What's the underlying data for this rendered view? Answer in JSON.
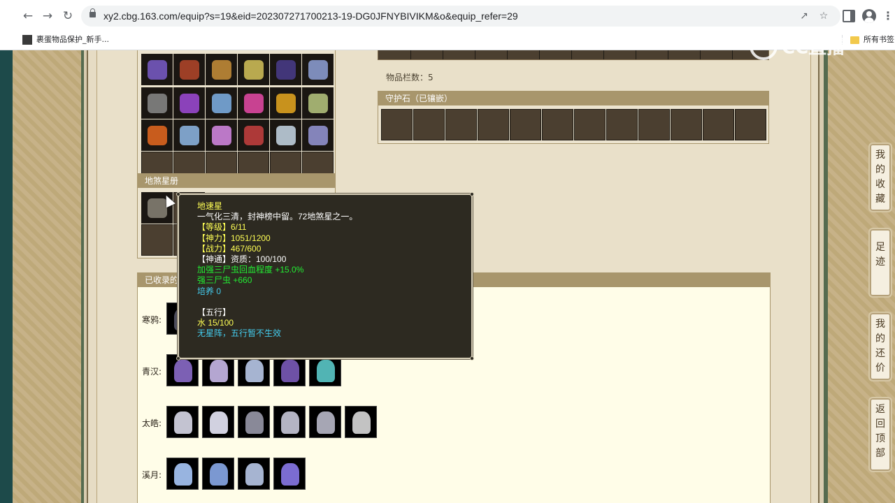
{
  "browser": {
    "url": "xy2.cbg.163.com/equip?s=19&eid=202307271700213-19-DG0JFNYBIVIKM&o&equip_refer=29",
    "bookmarks": [
      {
        "label": "裹蛋物品保护_新手..."
      }
    ],
    "all_bookmarks_label": "所有书签"
  },
  "equip_panel": {
    "icon_colors": [
      [
        "#7a5cc9",
        "#b5472a",
        "#c98f3a",
        "#d6c35a",
        "#4a3c8c",
        "#8fa1d8"
      ],
      [
        "#8a8a8a",
        "#a04ad8",
        "#7fb2e8",
        "#e84aa8",
        "#e8a820",
        "#b8c880"
      ],
      [
        "#e86820",
        "#8fb8e8",
        "#d88ae8",
        "#c84040",
        "#c8d8e8",
        "#9898d8"
      ]
    ]
  },
  "star_panel": {
    "title": "地煞星册"
  },
  "right_info": {
    "slot_count": "物品栏数：5",
    "guard_title": "守护石（已镶嵌）"
  },
  "collected_panel": {
    "title_visible": "已收录的",
    "rows": [
      {
        "label": "寒鸦:",
        "icon_colors": [
          "#555566"
        ]
      },
      {
        "label": "青汉:",
        "icon_colors": [
          "#8a6ac8",
          "#c8b8e8",
          "#b8c8e8",
          "#7a5ab8",
          "#5ac8c8"
        ]
      },
      {
        "label": "太皓:",
        "icon_colors": [
          "#d8d8e8",
          "#e8e8f8",
          "#9898a8",
          "#c8c8d8",
          "#b8b8c8",
          "#d8d8d8"
        ]
      },
      {
        "label": "溪月:",
        "icon_colors": [
          "#a8c8f8",
          "#88a8e8",
          "#b8c8e8",
          "#8878e8"
        ]
      }
    ]
  },
  "tooltip": {
    "lines": [
      {
        "text": "地速星",
        "color": "yellow"
      },
      {
        "text": "一气化三清，封神榜中留。72地煞星之一。",
        "color": "white"
      },
      {
        "text": "【等级】6/11",
        "color": "yellow"
      },
      {
        "text": "【神力】1051/1200",
        "color": "yellow"
      },
      {
        "text": "【战力】467/600",
        "color": "yellow"
      },
      {
        "text": "【神通】资质：100/100",
        "color": "white"
      },
      {
        "text": "加强三尸虫回血程度 +15.0%",
        "color": "green"
      },
      {
        "text": "强三尸虫 +660",
        "color": "green"
      },
      {
        "text": "培养 0",
        "color": "cyan"
      },
      {
        "text": "",
        "color": "white"
      },
      {
        "text": "【五行】",
        "color": "white"
      },
      {
        "text": "水 15/100",
        "color": "yellow"
      },
      {
        "text": "无星阵，五行暂不生效",
        "color": "cyan"
      }
    ]
  },
  "side_nav": [
    {
      "label": "我的收藏"
    },
    {
      "label": "足迹"
    },
    {
      "label": "我的还价"
    },
    {
      "label": "返回顶部"
    }
  ],
  "watermark": {
    "text": "CC直播"
  }
}
